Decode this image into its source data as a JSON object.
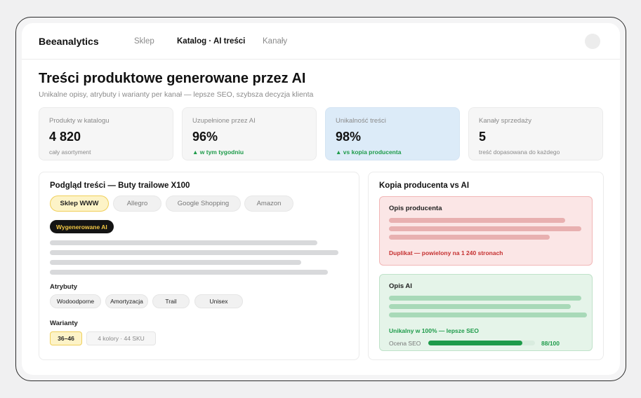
{
  "app": {
    "brand": "Beeanalytics",
    "nav": [
      {
        "label": "Sklep"
      },
      {
        "label": "Katalog · AI treści"
      },
      {
        "label": "Kanały"
      }
    ]
  },
  "page": {
    "title": "Treści produktowe generowane przez AI",
    "subtitle": "Unikalne opisy, atrybuty i warianty per kanał — lepsze SEO, szybsza decyzja klienta"
  },
  "kpis": [
    {
      "label": "Produkty w katalogu",
      "value": "4 820",
      "note": "cały asortyment"
    },
    {
      "label": "Uzupełnione przez AI",
      "value": "96%",
      "note": "▲ w tym tygodniu"
    },
    {
      "label": "Unikalność treści",
      "value": "98%",
      "note": "▲ vs kopia producenta"
    },
    {
      "label": "Kanały sprzedaży",
      "value": "5",
      "note": "treść dopasowana do każdego"
    }
  ],
  "preview": {
    "title": "Podgląd treści — Buty trailowe X100",
    "tabs": [
      {
        "label": "Sklep WWW",
        "active": true
      },
      {
        "label": "Allegro"
      },
      {
        "label": "Google Shopping"
      },
      {
        "label": "Amazon"
      }
    ],
    "badge": "Wygenerowane AI",
    "attributes_label": "Atrybuty",
    "attributes": [
      "Wodoodporne",
      "Amortyzacja",
      "Trail",
      "Unisex"
    ],
    "variants_label": "Warianty",
    "variants": [
      {
        "label": "36–46",
        "selected": true
      },
      {
        "label": "4 kolory · 44 SKU"
      }
    ]
  },
  "comparison": {
    "title": "Kopia producenta vs AI",
    "producer": {
      "title": "Opis producenta",
      "status": "Duplikat — powielony na 1 240 stronach"
    },
    "ai": {
      "title": "Opis AI",
      "status": "Unikalny w 100% — lepsze SEO",
      "score_label": "Ocena SEO",
      "score_text": "88/100",
      "score_fraction": 0.88
    }
  },
  "colors": {
    "accent_yellow": "#f0cf5a",
    "success_green": "#1e9b4a",
    "danger_red": "#c53030",
    "highlight_blue": "#dcebf8"
  }
}
